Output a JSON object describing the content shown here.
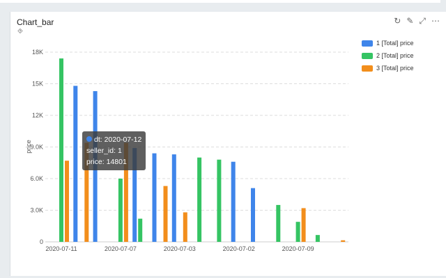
{
  "card": {
    "title": "Chart_bar"
  },
  "tooltip": {
    "dt": "dt: 2020-07-12",
    "seller": "seller_id: 1",
    "price": "price: 14801"
  },
  "chart_data": {
    "type": "bar",
    "title": "Chart_bar",
    "xlabel": "",
    "ylabel": "price",
    "ylim": [
      0,
      18000
    ],
    "yticks": [
      0,
      3000,
      6000,
      9000,
      12000,
      15000,
      18000
    ],
    "ytick_labels": [
      "0",
      "3.0K",
      "6.0K",
      "9.0K",
      "12K",
      "15K",
      "18K"
    ],
    "grid": true,
    "legend_position": "right",
    "categories": [
      "2020-07-11",
      "",
      "",
      "2020-07-07",
      "",
      "",
      "2020-07-03",
      "",
      "",
      "2020-07-02",
      "",
      "",
      "2020-07-09",
      "",
      ""
    ],
    "series": [
      {
        "name": "1 [Total] price",
        "color": "#3f85ea",
        "values": [
          null,
          14801,
          14300,
          null,
          8900,
          8400,
          8300,
          null,
          null,
          7600,
          5100,
          null,
          null,
          null,
          null
        ]
      },
      {
        "name": "2 [Total] price",
        "color": "#35c463",
        "values": [
          17400,
          null,
          null,
          6000,
          2200,
          null,
          null,
          8000,
          7800,
          null,
          null,
          3500,
          1900,
          650,
          null
        ]
      },
      {
        "name": "3 [Total] price",
        "color": "#f28e1c",
        "values": [
          7700,
          9400,
          null,
          9400,
          null,
          5300,
          2800,
          null,
          null,
          null,
          null,
          null,
          3200,
          null,
          150
        ]
      }
    ]
  }
}
